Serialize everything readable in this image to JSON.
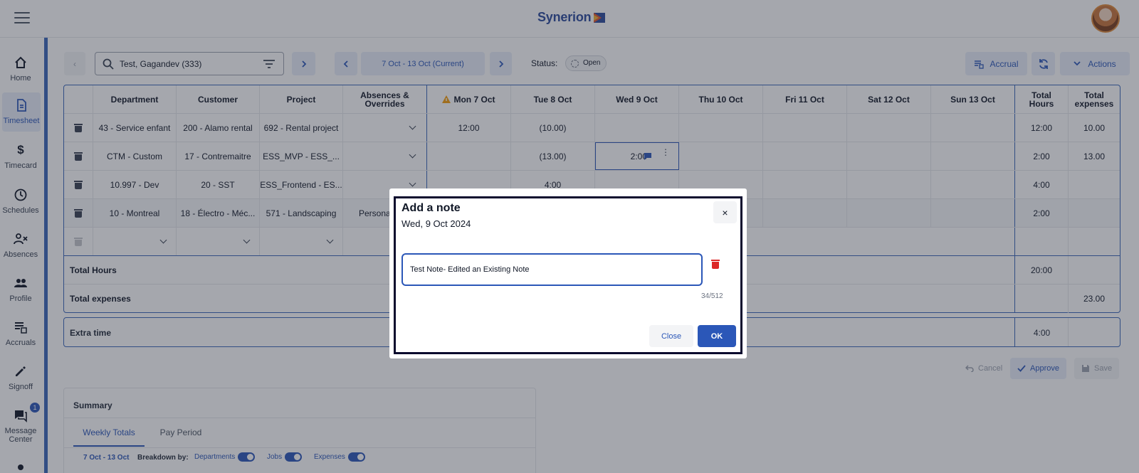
{
  "app": {
    "brand": "Synerion"
  },
  "nav": {
    "items": [
      {
        "label": "Home",
        "icon": "home-icon"
      },
      {
        "label": "Timesheet",
        "icon": "timesheet-icon"
      },
      {
        "label": "Timecard",
        "icon": "dollar-icon"
      },
      {
        "label": "Schedules",
        "icon": "clock-icon"
      },
      {
        "label": "Absences",
        "icon": "absences-icon"
      },
      {
        "label": "Profile",
        "icon": "profile-icon"
      },
      {
        "label": "Accruals",
        "icon": "accruals-icon"
      },
      {
        "label": "Signoff",
        "icon": "signoff-icon"
      },
      {
        "label": "Message\nCenter",
        "icon": "message-icon",
        "badge": "1"
      }
    ],
    "active": "Timesheet"
  },
  "toolbar": {
    "employee": "Test, Gagandev (333)",
    "week_range": "7 Oct - 13 Oct (Current)",
    "status_label": "Status:",
    "status_value": "Open",
    "accrual_label": "Accrual",
    "actions_label": "Actions"
  },
  "table": {
    "headers": [
      "Department",
      "Customer",
      "Project",
      "Absences &\nOverrides",
      "Mon 7 Oct",
      "Tue 8 Oct",
      "Wed 9 Oct",
      "Thu 10 Oct",
      "Fri 11 Oct",
      "Sat 12 Oct",
      "Sun 13 Oct",
      "Total\nHours",
      "Total\nexpenses"
    ],
    "rows": [
      {
        "department": "43 - Service enfant",
        "customer": "200 - Alamo rental",
        "project": "692 - Rental project",
        "absence": "",
        "mon": "12:00",
        "tue": "(10.00)",
        "wed": "",
        "total_hours": "12:00",
        "total_expenses": "10.00"
      },
      {
        "department": "CTM - Custom",
        "customer": "17 - Contremaitre",
        "project": "ESS_MVP - ESS_...",
        "absence": "",
        "mon": "",
        "tue": "(13.00)",
        "wed": "2:00",
        "total_hours": "2:00",
        "total_expenses": "13.00"
      },
      {
        "department": "10.997 - Dev",
        "customer": "20 - SST",
        "project": "ESS_Frontend - ES...",
        "absence": "",
        "mon": "",
        "tue": "4:00",
        "wed": "",
        "total_hours": "4:00",
        "total_expenses": ""
      },
      {
        "department": "10 - Montreal",
        "customer": "18 - Électro - Méc...",
        "project": "571 - Landscaping",
        "absence": "Persona",
        "mon": "",
        "tue": "",
        "wed": "",
        "total_hours": "2:00",
        "total_expenses": ""
      }
    ],
    "total_hours_label": "Total Hours",
    "total_hours_value": "20:00",
    "total_expenses_label": "Total expenses",
    "total_expenses_value": "23.00",
    "extra_time_label": "Extra time",
    "extra_time_value": "4:00"
  },
  "bottom_actions": {
    "cancel": "Cancel",
    "approve": "Approve",
    "save": "Save"
  },
  "summary": {
    "title": "Summary",
    "tabs": [
      "Weekly Totals",
      "Pay Period"
    ],
    "range": "7 Oct - 13 Oct",
    "breakdown_label": "Breakdown by:",
    "toggles": [
      "Departments",
      "Jobs",
      "Expenses"
    ]
  },
  "modal": {
    "title": "Add a note",
    "subtitle": "Wed, 9 Oct 2024",
    "note_value": "Test Note- Edited an Existing Note",
    "counter": "34/512",
    "close_label": "Close",
    "ok_label": "OK",
    "close_icon": "×"
  }
}
